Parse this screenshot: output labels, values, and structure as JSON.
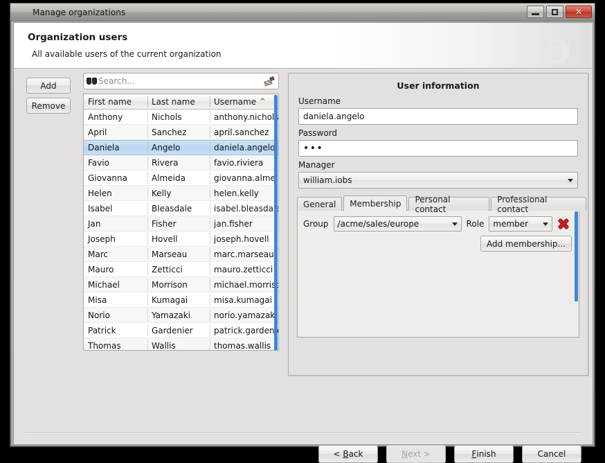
{
  "window": {
    "title": "Manage organizations",
    "app_icon": "swirl-logo-icon",
    "minimize_label": "Minimize",
    "maximize_label": "Maximize",
    "close_label": "✕"
  },
  "banner": {
    "heading": "Organization users",
    "subheading": "All available users of the current organization",
    "logo_glyph": "ↄ"
  },
  "left_buttons": {
    "add": "Add",
    "remove": "Remove"
  },
  "search": {
    "placeholder": "Search...",
    "value": "",
    "left_icon": "binoculars-icon",
    "right_icon": "eraser-clear-icon"
  },
  "table": {
    "columns": [
      "First name",
      "Last name",
      "Username"
    ],
    "sort_column": "Username",
    "sort_indicator": "^",
    "selected_index": 2,
    "rows": [
      {
        "first": "Anthony",
        "last": "Nichols",
        "username": "anthony.nichols"
      },
      {
        "first": "April",
        "last": "Sanchez",
        "username": "april.sanchez"
      },
      {
        "first": "Daniela",
        "last": "Angelo",
        "username": "daniela.angelo"
      },
      {
        "first": "Favio",
        "last": "Rivera",
        "username": "favio.riviera"
      },
      {
        "first": "Giovanna",
        "last": "Almeida",
        "username": "giovanna.almeida"
      },
      {
        "first": "Helen",
        "last": "Kelly",
        "username": "helen.kelly"
      },
      {
        "first": "Isabel",
        "last": "Bleasdale",
        "username": "isabel.bleasdale"
      },
      {
        "first": "Jan",
        "last": "Fisher",
        "username": "jan.fisher"
      },
      {
        "first": "Joseph",
        "last": "Hovell",
        "username": "joseph.hovell"
      },
      {
        "first": "Marc",
        "last": "Marseau",
        "username": "marc.marseau"
      },
      {
        "first": "Mauro",
        "last": "Zetticci",
        "username": "mauro.zetticci"
      },
      {
        "first": "Michael",
        "last": "Morrison",
        "username": "michael.morrison"
      },
      {
        "first": "Misa",
        "last": "Kumagai",
        "username": "misa.kumagai"
      },
      {
        "first": "Norio",
        "last": "Yamazaki",
        "username": "norio.yamazaki"
      },
      {
        "first": "Patrick",
        "last": "Gardenier",
        "username": "patrick.gardenier"
      },
      {
        "first": "Thomas",
        "last": "Wallis",
        "username": "thomas.wallis"
      }
    ]
  },
  "user_info": {
    "panel_title": "User information",
    "username_label": "Username",
    "username_value": "daniela.angelo",
    "password_label": "Password",
    "password_value": "•••",
    "manager_label": "Manager",
    "manager_value": "william.iobs"
  },
  "tabs": {
    "items": [
      {
        "label": "General",
        "active": false
      },
      {
        "label": "Membership",
        "active": true
      },
      {
        "label": "Personal contact",
        "active": false
      },
      {
        "label": "Professional contact",
        "active": false
      }
    ]
  },
  "membership": {
    "group_label": "Group",
    "group_value": "/acme/sales/europe",
    "role_label": "Role",
    "role_value": "member",
    "delete_icon": "red-x-delete-icon",
    "add_button": "Add membership..."
  },
  "footer": {
    "back": "< Back",
    "back_mnemonic": "B",
    "next": "Next >",
    "next_mnemonic": "N",
    "next_disabled": true,
    "finish": "Finish",
    "finish_mnemonic": "F",
    "cancel": "Cancel"
  },
  "colors": {
    "selection_blue": "#b9d6f2",
    "scrollbar_blue": "#3c88d8",
    "accent_red": "#cf1525",
    "window_bg": "#e2e1df"
  }
}
